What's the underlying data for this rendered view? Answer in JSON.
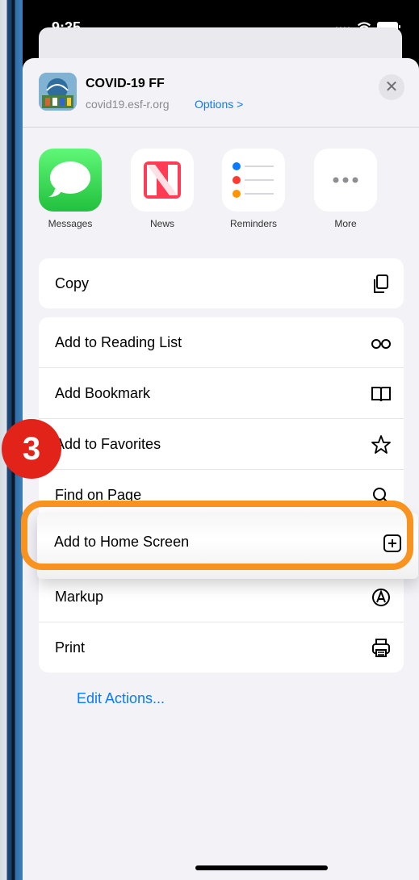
{
  "status": {
    "time": "9:35"
  },
  "share_header": {
    "title": "COVID-19 FF",
    "url": "covid19.esf-r.org",
    "options_label": "Options >",
    "close_glyph": "✕"
  },
  "apps": [
    {
      "label": "Messages",
      "icon": "messages-icon",
      "color": "#34c759"
    },
    {
      "label": "News",
      "icon": "news-icon",
      "color": "#ff3b55"
    },
    {
      "label": "Reminders",
      "icon": "reminders-icon",
      "color": "#ffffff"
    },
    {
      "label": "More",
      "icon": "more-icon",
      "color": "#ffffff"
    }
  ],
  "actions": {
    "copy": "Copy",
    "reading_list": "Add to Reading List",
    "bookmark": "Add Bookmark",
    "favorites": "Add to Favorites",
    "find": "Find on Page",
    "home_screen": "Add to Home Screen",
    "markup": "Markup",
    "print": "Print"
  },
  "edit_actions": "Edit Actions...",
  "annotation": {
    "step_number": "3",
    "ring_color": "#f7931e",
    "badge_color": "#e2231a"
  }
}
